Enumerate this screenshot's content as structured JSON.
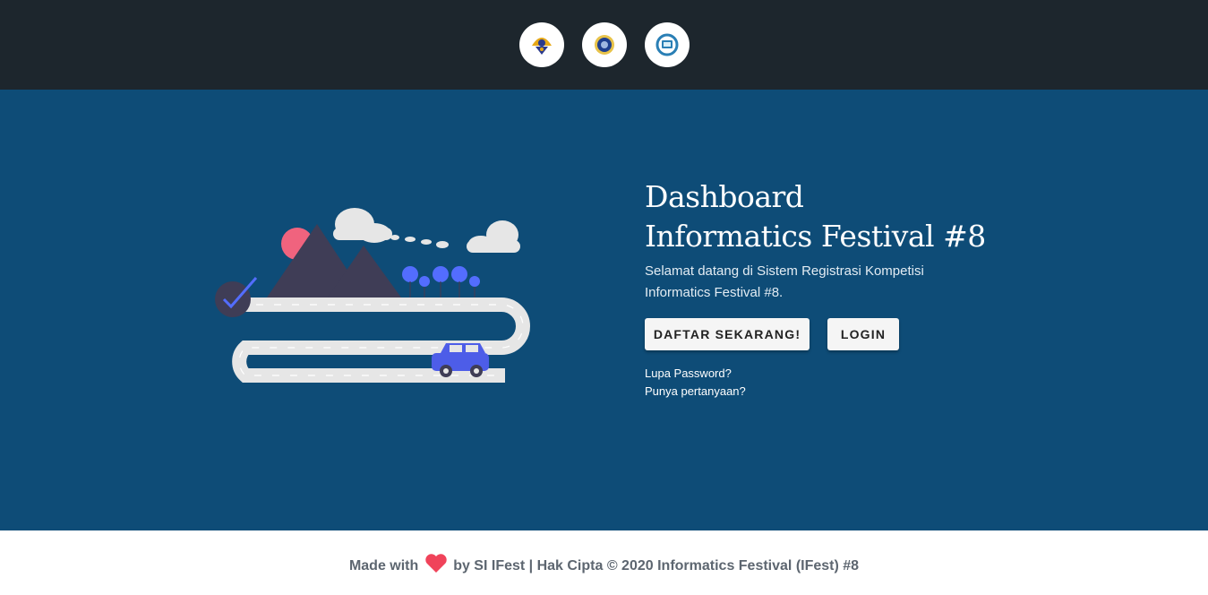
{
  "header": {
    "logos": [
      {
        "name": "tut-wuri-handayani-logo",
        "color": "#e6a817"
      },
      {
        "name": "university-logo",
        "color": "#1f3f8f"
      },
      {
        "name": "ifest-logo",
        "color": "#2a7fb5"
      }
    ]
  },
  "hero": {
    "title_line1": "Dashboard",
    "title_line2": "Informatics Festival #8",
    "subtitle": "Selamat datang di Sistem Registrasi Kompetisi Informatics Festival #8.",
    "register_button": "DAFTAR SEKARANG!",
    "login_button": "LOGIN",
    "forgot_password_link": "Lupa Password?",
    "question_link": "Punya pertanyaan?"
  },
  "footer": {
    "made_with": "Made with",
    "by_text": "by SI IFest | Hak Cipta © 2020 Informatics Festival (IFest) #8"
  },
  "colors": {
    "topbar": "#1d262d",
    "hero": "#0e4c77",
    "heart": "#f0435a",
    "car": "#4d5de8",
    "mountain": "#3f3d56",
    "sun": "#f0637e"
  }
}
